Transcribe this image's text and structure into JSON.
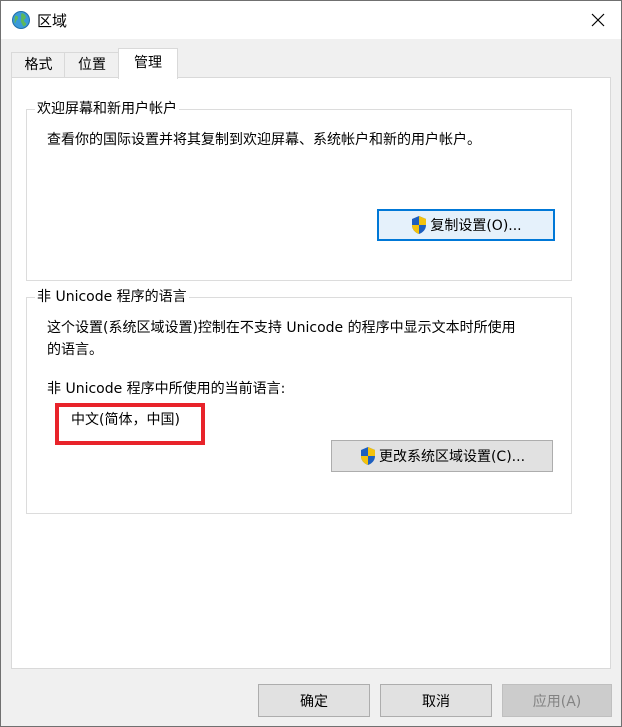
{
  "window": {
    "title": "区域",
    "icon": "globe-icon",
    "close_icon": "close-icon"
  },
  "tabs": [
    {
      "label": "格式",
      "active": false
    },
    {
      "label": "位置",
      "active": false
    },
    {
      "label": "管理",
      "active": true
    }
  ],
  "welcome_group": {
    "title": "欢迎屏幕和新用户帐户",
    "description": "查看你的国际设置并将其复制到欢迎屏幕、系统帐户和新的用户帐户。",
    "copy_button": "复制设置(O)..."
  },
  "unicode_group": {
    "title": "非 Unicode 程序的语言",
    "description_line1": "这个设置(系统区域设置)控制在不支持 Unicode 的程序中显示文本时所使用",
    "description_line2": "的语言。",
    "current_label": "非 Unicode 程序中所使用的当前语言:",
    "current_value": "中文(简体，中国)",
    "change_button": "更改系统区域设置(C)..."
  },
  "footer": {
    "ok": "确定",
    "cancel": "取消",
    "apply": "应用(A)"
  },
  "colors": {
    "highlight_box": "#e8232a",
    "default_button_border": "#0078d7",
    "window_bg": "#f0f0f0"
  }
}
